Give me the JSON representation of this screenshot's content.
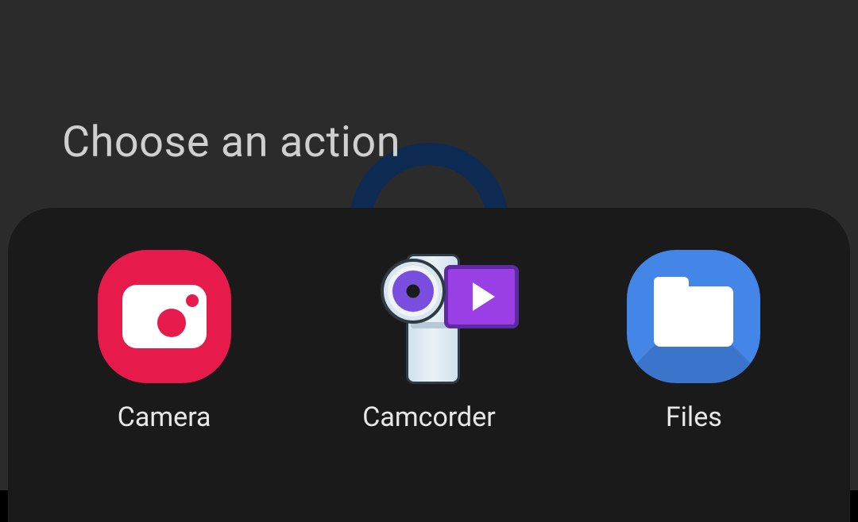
{
  "sheet": {
    "title": "Choose an action",
    "actions": [
      {
        "label": "Camera",
        "icon": "camera-icon"
      },
      {
        "label": "Camcorder",
        "icon": "camcorder-icon"
      },
      {
        "label": "Files",
        "icon": "files-icon"
      }
    ]
  }
}
